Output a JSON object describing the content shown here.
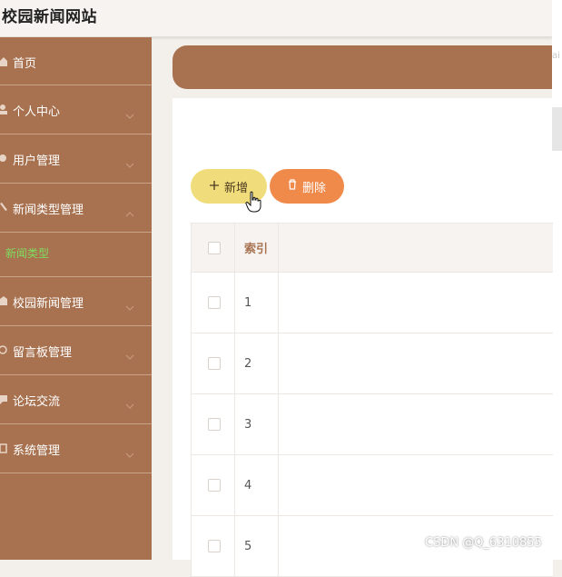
{
  "app": {
    "title": "校园新闻网站"
  },
  "sidebar": {
    "items": [
      {
        "label": "首页",
        "icon": "home-icon",
        "expanded": false
      },
      {
        "label": "个人中心",
        "icon": "user-icon",
        "expanded": false
      },
      {
        "label": "用户管理",
        "icon": "users-icon",
        "expanded": false
      },
      {
        "label": "新闻类型管理",
        "icon": "edit-icon",
        "expanded": true
      },
      {
        "label": "校园新闻管理",
        "icon": "news-icon",
        "expanded": false
      },
      {
        "label": "留言板管理",
        "icon": "message-icon",
        "expanded": false
      },
      {
        "label": "论坛交流",
        "icon": "forum-icon",
        "expanded": false
      },
      {
        "label": "系统管理",
        "icon": "settings-icon",
        "expanded": false
      }
    ],
    "submenu": {
      "label": "新闻类型"
    }
  },
  "toolbar": {
    "add_label": "新增",
    "delete_label": "删除"
  },
  "table": {
    "headers": {
      "index": "索引"
    },
    "rows": [
      "1",
      "2",
      "3",
      "4",
      "5"
    ]
  },
  "colors": {
    "brand": "#a87250",
    "add": "#f1dc7c",
    "delete": "#f08a4b",
    "active": "#7fdc5f"
  },
  "watermark": "CSDN @Q_6310855"
}
